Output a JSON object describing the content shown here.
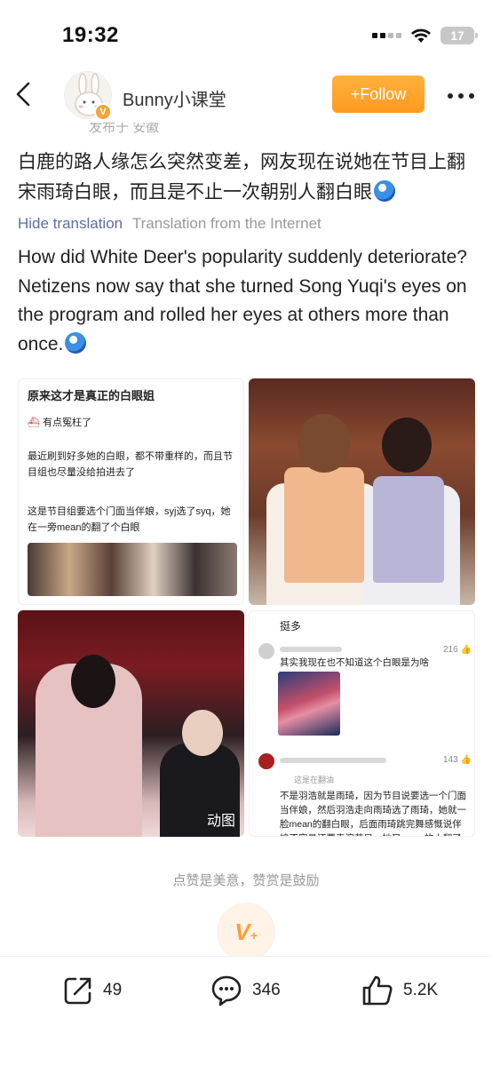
{
  "status_bar": {
    "time": "19:32",
    "battery": "17"
  },
  "header": {
    "username": "Bunny小课堂",
    "follow_label": "+Follow",
    "location_text": "发布于 安徽"
  },
  "post": {
    "title_zh": "白鹿的路人缘怎么突然变差，网友现在说她在节目上翻宋雨琦白眼，而且是不止一次朝别人翻白眼",
    "hide_translation": "Hide translation",
    "translation_source": "Translation from the Internet",
    "title_en": "How did White Deer's popularity suddenly deteriorate? Netizens now say that she turned Song Yuqi's eyes on the program and rolled her eyes at others more than once."
  },
  "images": {
    "img1": {
      "title": "原来这才是真正的白眼姐",
      "line1": "有点冤枉了",
      "line2": "最近刷到好多她的白眼，都不带重样的，而且节目组也尽量没给拍进去了",
      "line3": "这是节目组要选个门面当伴娘，syj选了syq，她在一旁mean的翻了个白眼"
    },
    "img3": {
      "badge": "动图"
    },
    "img4": {
      "header": "挺多",
      "c1_text": "其实我现在也不知道这个白眼是为啥",
      "c1_likes": "216",
      "c2_likes": "143",
      "c2_reply": "这是在翻油",
      "c2_text": "不是羽浩就是雨琦，因为节目说要选一个门面当伴娘，然后羽浩走向雨琦选了雨琦，她就一脸mean的翻白眼，后面雨琦跳完舞感慨说伴娘不容易还要表演节目，她又mean的小翻了一下白"
    }
  },
  "reward": {
    "text": "点赞是美意，赞赏是鼓励"
  },
  "actions": {
    "share_count": "49",
    "comment_count": "346",
    "like_count": "5.2K"
  }
}
